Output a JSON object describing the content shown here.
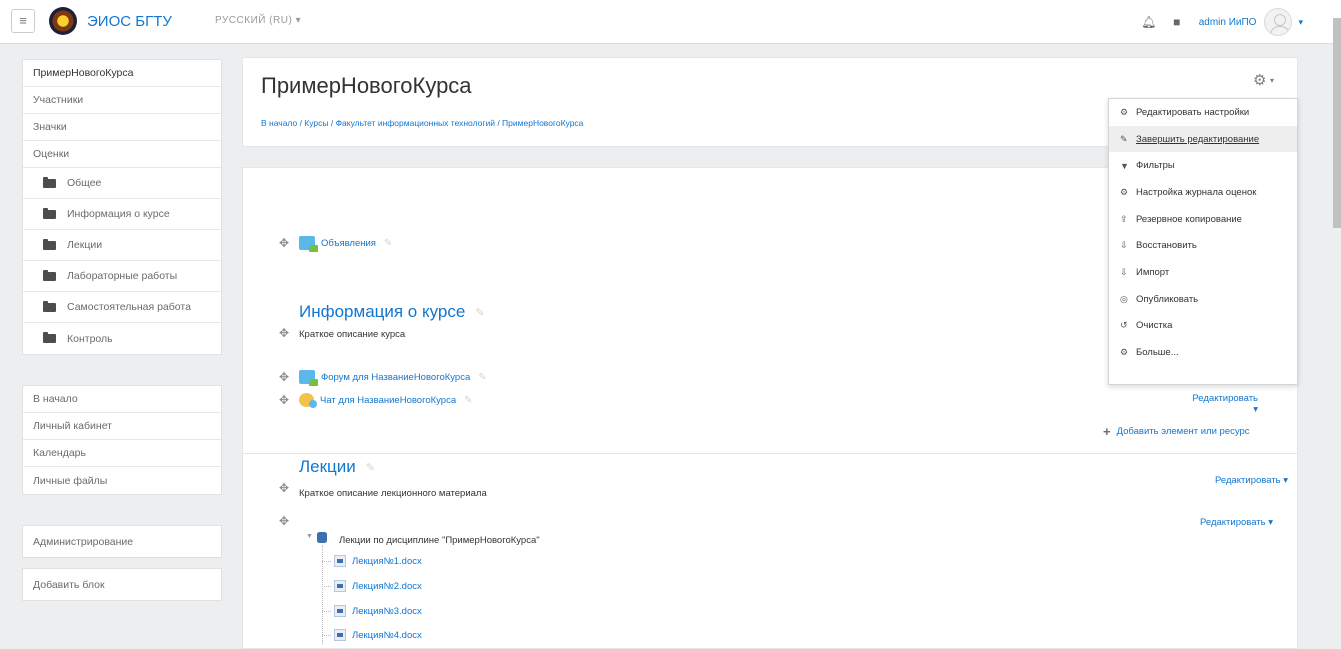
{
  "navbar": {
    "menu_glyph": "≡",
    "brand": "ЭИОС БГТУ",
    "language": "РУССКИЙ (RU) ▾",
    "user_name": "admin ИиПО",
    "icons": [
      "notifications-bell-icon",
      "messages-icon",
      "user-avatar"
    ]
  },
  "left_nav": {
    "items": [
      {
        "label": "ПримерНовогоКурса",
        "section": false,
        "active": true
      },
      {
        "label": "Участники",
        "section": false
      },
      {
        "label": "Значки",
        "section": false
      },
      {
        "label": "Оценки",
        "section": false
      },
      {
        "label": "Общее",
        "section": true
      },
      {
        "label": "Информация о курсе",
        "section": true
      },
      {
        "label": "Лекции",
        "section": true
      },
      {
        "label": "Лабораторные работы",
        "section": true
      },
      {
        "label": "Самостоятельная работа",
        "section": true
      },
      {
        "label": "Контроль",
        "section": true
      }
    ],
    "site_items": [
      "В начало",
      "Личный кабинет",
      "Календарь",
      "Личные файлы"
    ],
    "admin": "Администрирование",
    "add_block": "Добавить блок"
  },
  "header": {
    "title": "ПримерНовогоКурса",
    "breadcrumb": "В начало / Курсы / Факультет информационных технологий / ПримерНовогоКурса"
  },
  "course_menu": {
    "items": [
      {
        "icon": "⚙",
        "label": "Редактировать настройки"
      },
      {
        "icon": "✎",
        "label": "Завершить редактирование",
        "hover": true
      },
      {
        "icon": "▼",
        "label": "Фильтры"
      },
      {
        "icon": "⚙",
        "label": "Настройка журнала оценок"
      },
      {
        "icon": "⇪",
        "label": "Резервное копирование"
      },
      {
        "icon": "⇩",
        "label": "Восстановить"
      },
      {
        "icon": "⇩",
        "label": "Импорт"
      },
      {
        "icon": "◎",
        "label": "Опубликовать"
      },
      {
        "icon": "↺",
        "label": "Очистка"
      },
      {
        "icon": "⚙",
        "label": "Больше..."
      }
    ]
  },
  "sections": {
    "general": {
      "activity": "Объявления",
      "edit": "Редактировать ▾",
      "add": "Добавить элемент или ресурс"
    },
    "info": {
      "title": "Информация о курсе",
      "summary": "Краткое описание курса",
      "forum": "Форум для НазваниеНовогоКурса",
      "chat": "Чат для НазваниеНовогоКурса"
    },
    "lectures": {
      "title": "Лекции",
      "summary": "Краткое описание лекционного материала",
      "edit": "Редактировать ▾",
      "item_edit": "Редактировать ▾",
      "folder": "Лекции по дисциплине \"ПримерНовогоКурса\"",
      "files": [
        "Лекция№1.docx",
        "Лекция№2.docx",
        "Лекция№3.docx",
        "Лекция№4.docx"
      ]
    }
  },
  "colors": {
    "link": "#1177d1",
    "background": "#eceeef"
  }
}
